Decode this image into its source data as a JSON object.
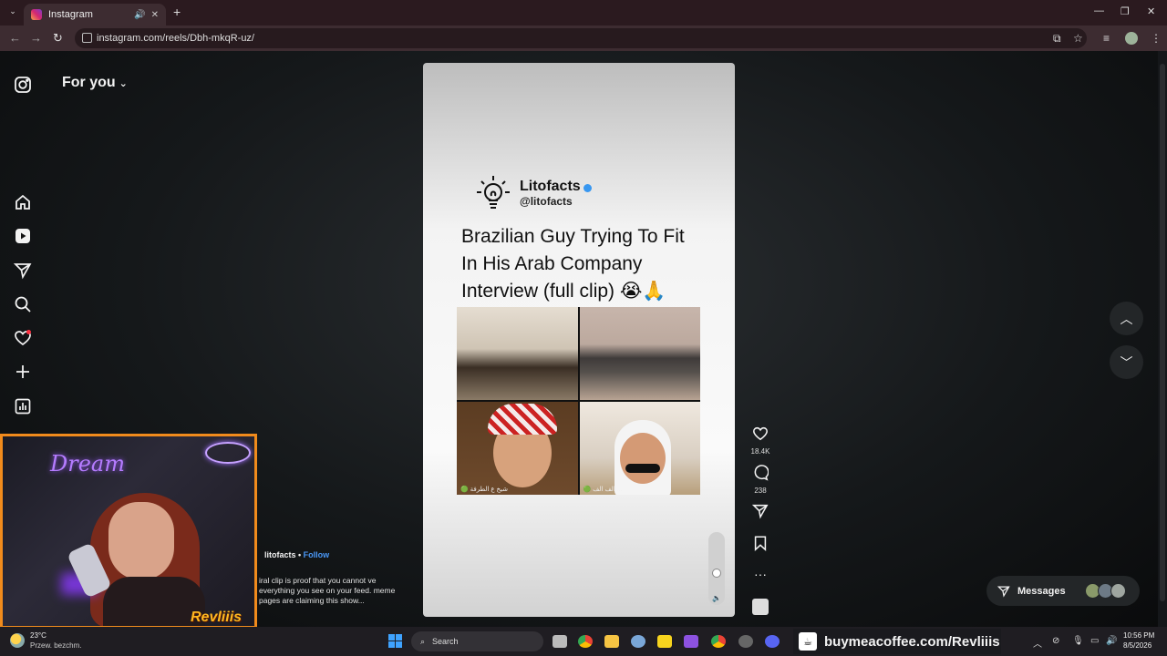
{
  "browser": {
    "tab_title": "Instagram",
    "url": "instagram.com/reels/Dbh-mkqR-uz/"
  },
  "sidebar": {
    "feed_label": "For you"
  },
  "reel": {
    "channel_name": "Litofacts",
    "channel_handle": "@litofacts",
    "headline": "Brazilian Guy Trying To Fit In His Arab Company Interview (full clip) 😭🙏",
    "video_label_left": "🟢 شيخ ع الطرفة",
    "video_label_right": "🟢 الف الف ..."
  },
  "actions": {
    "likes": "18.4K",
    "comments": "238"
  },
  "author": {
    "name": "litofacts",
    "separator": " • ",
    "follow": "Follow",
    "caption": "iral clip is proof that you cannot ve everything you see on your feed. meme pages are claiming this show..."
  },
  "messages": {
    "label": "Messages"
  },
  "webcam": {
    "neon_text": "Dream",
    "brand": "Revliiis"
  },
  "taskbar": {
    "weather_temp": "23°C",
    "weather_desc": "Przew. bezchm.",
    "search": "Search",
    "coffee_link": "buymeacoffee.com/Revliiis",
    "time": "10:56 PM",
    "date": "8/5/2026"
  },
  "colors": {
    "accent_follow": "#4a98f7",
    "webcam_border": "#f18b1c",
    "notification_dot": "#ff3040"
  }
}
